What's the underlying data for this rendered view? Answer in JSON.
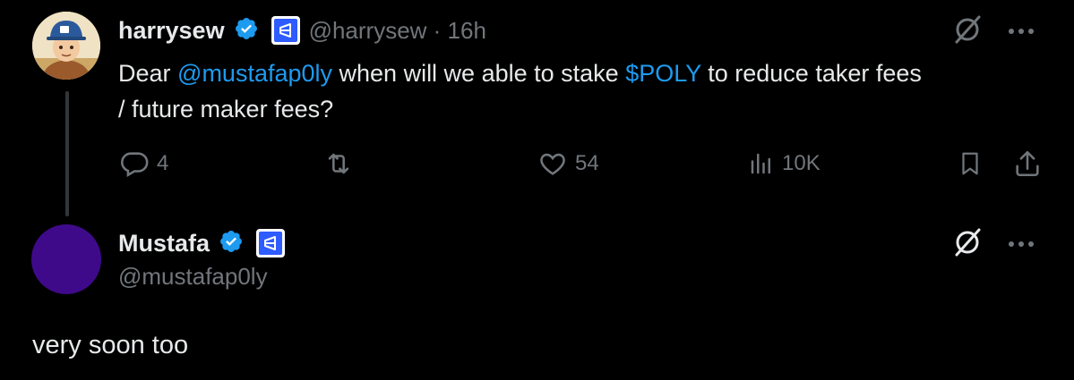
{
  "post": {
    "display_name": "harrysew",
    "handle_time": "@harrysew · 16h",
    "text_intro": "Dear ",
    "mention": "@mustafap0ly",
    "text_mid": " when will we able to stake ",
    "cashtag": "$POLY",
    "text_line1_end": " to reduce taker fees",
    "text_line2": "/ future maker fees?",
    "replies": "4",
    "likes": "54",
    "views": "10K"
  },
  "reply": {
    "display_name": "Mustafa",
    "handle": "@mustafap0ly",
    "text": "very soon too"
  },
  "icons": {
    "verified": "verified-badge-icon",
    "affiliation": "polymarket-affiliate-icon",
    "grok": "grok-icon",
    "more": "more-icon",
    "reply": "reply-icon",
    "retweet": "retweet-icon",
    "like": "like-icon",
    "views": "views-icon",
    "bookmark": "bookmark-icon",
    "share": "share-icon"
  },
  "colors": {
    "background": "#000000",
    "text": "#e7e9ea",
    "muted": "#71767b",
    "link": "#1d9bf0",
    "verified": "#1d9bf0",
    "avatar_reply": "#3f0a8a"
  }
}
